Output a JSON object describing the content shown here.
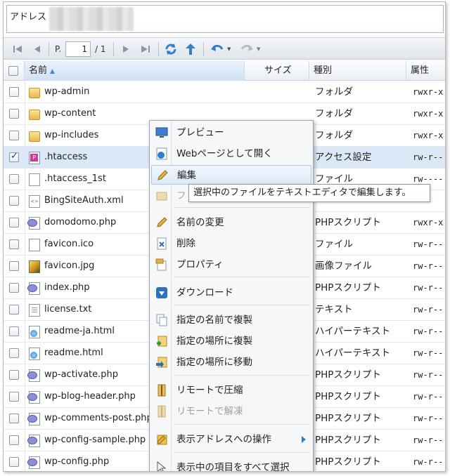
{
  "address": {
    "label": "アドレス"
  },
  "toolbar": {
    "icons": {
      "first": "first-page-icon",
      "prev": "prev-page-icon",
      "next": "next-page-icon",
      "last": "last-page-icon",
      "refresh": "refresh-icon",
      "up": "up-folder-icon",
      "back": "back-icon",
      "forward": "forward-icon"
    },
    "page_label": "P.",
    "page_value": "1",
    "page_total": "/ 1"
  },
  "grid": {
    "columns": {
      "name": "名前",
      "size": "サイズ",
      "type": "種別",
      "attr": "属性"
    },
    "rows": [
      {
        "name": "wp-admin",
        "type": "フォルダ",
        "attr": "rwxr-x",
        "icon": "folder-icon"
      },
      {
        "name": "wp-content",
        "type": "フォルダ",
        "attr": "rwxr-x",
        "icon": "folder-icon"
      },
      {
        "name": "wp-includes",
        "type": "フォルダ",
        "attr": "rwxr-x",
        "icon": "folder-icon"
      },
      {
        "name": ".htaccess",
        "type": "アクセス設定",
        "attr": "rw-r--",
        "icon": "htaccess-icon",
        "selected": true
      },
      {
        "name": ".htaccess_1st",
        "type": "ファイル",
        "attr": "rw----",
        "icon": "file-icon"
      },
      {
        "name": "BingSiteAuth.xml",
        "type": "",
        "attr": "",
        "icon": "xml-icon"
      },
      {
        "name": "domodomo.php",
        "type": "PHPスクリプト",
        "attr": "rwxr-x",
        "icon": "php-icon"
      },
      {
        "name": "favicon.ico",
        "type": "ファイル",
        "attr": "rw-r--",
        "icon": "file-icon"
      },
      {
        "name": "favicon.jpg",
        "type": "画像ファイル",
        "attr": "rw-r--",
        "icon": "image-icon"
      },
      {
        "name": "index.php",
        "type": "PHPスクリプト",
        "attr": "rw-r--",
        "icon": "php-icon"
      },
      {
        "name": "license.txt",
        "type": "テキスト",
        "attr": "rw-r--",
        "icon": "text-file-icon"
      },
      {
        "name": "readme-ja.html",
        "type": "ハイパーテキスト",
        "attr": "rw-r--",
        "icon": "html-icon"
      },
      {
        "name": "readme.html",
        "type": "ハイパーテキスト",
        "attr": "rw-r--",
        "icon": "html-icon"
      },
      {
        "name": "wp-activate.php",
        "type": "PHPスクリプト",
        "attr": "rw-r--",
        "icon": "php-icon"
      },
      {
        "name": "wp-blog-header.php",
        "type": "PHPスクリプト",
        "attr": "rw-r--",
        "icon": "php-icon"
      },
      {
        "name": "wp-comments-post.php",
        "type": "PHPスクリプト",
        "attr": "rw-r--",
        "icon": "php-icon"
      },
      {
        "name": "wp-config-sample.php",
        "type": "PHPスクリプト",
        "attr": "rw-r--",
        "icon": "php-icon"
      },
      {
        "name": "wp-config.php",
        "type": "PHPスクリプト",
        "attr": "rw-r--",
        "icon": "php-icon"
      }
    ]
  },
  "context_menu": {
    "items": [
      {
        "label": "プレビュー",
        "icon": "monitor-icon"
      },
      {
        "label": "Webページとして開く",
        "icon": "globe-icon"
      },
      {
        "label": "編集",
        "icon": "pencil-icon",
        "highlighted": true
      },
      {
        "label": "フ",
        "icon": "folder-open-icon",
        "disabled": true
      },
      {
        "label": "名前の変更",
        "icon": "rename-pencil-icon"
      },
      {
        "label": "削除",
        "icon": "delete-icon"
      },
      {
        "label": "プロパティ",
        "icon": "properties-icon"
      },
      {
        "label": "ダウンロード",
        "icon": "download-icon"
      },
      {
        "label": "指定の名前で複製",
        "icon": "copy-icon"
      },
      {
        "label": "指定の場所に複製",
        "icon": "copy-to-icon"
      },
      {
        "label": "指定の場所に移動",
        "icon": "move-to-icon"
      },
      {
        "label": "リモートで圧縮",
        "icon": "compress-icon"
      },
      {
        "label": "リモートで解凍",
        "icon": "extract-icon",
        "disabled": true
      },
      {
        "label": "表示アドレスへの操作",
        "icon": "address-action-icon",
        "submenu": true
      },
      {
        "label": "表示中の項目をすべて選択",
        "icon": "cursor-icon"
      }
    ]
  },
  "tooltip": {
    "text": "選択中のファイルをテキストエディタで編集します。"
  },
  "colors": {
    "selection": "#dce8f7",
    "accent": "#2f7fc9",
    "menu_highlight": "#dde9f7"
  }
}
